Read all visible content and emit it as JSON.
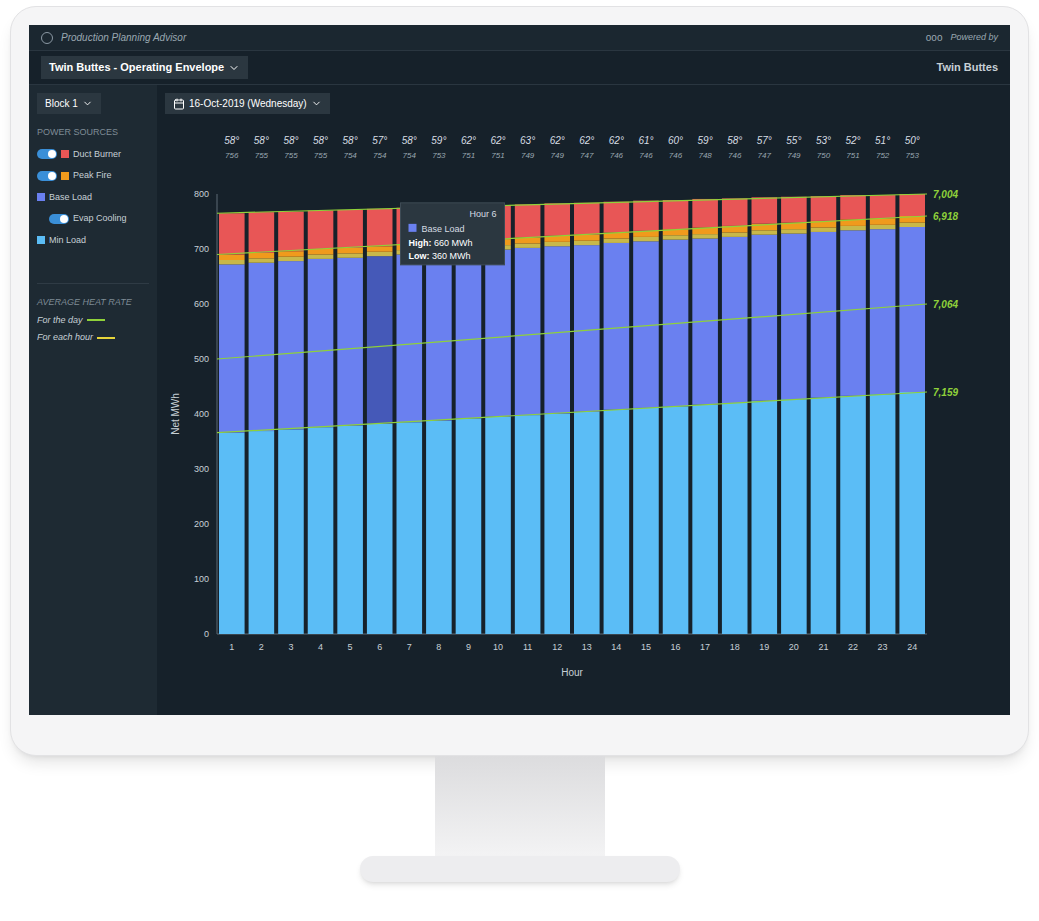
{
  "header": {
    "app": "Production Planning Advisor",
    "menu": "ooo",
    "poweredBy": "Powered by"
  },
  "plantSelect": "Twin Buttes - Operating Envelope",
  "siteName": "Twin Buttes",
  "blockSelect": "Block 1",
  "dateSelect": "16-Oct-2019 (Wednesday)",
  "legend": {
    "title": "POWER SOURCES",
    "items": [
      {
        "label": "Duct Burner",
        "kind": "toggle",
        "on": true,
        "sub": false,
        "color": "#e85656"
      },
      {
        "label": "Peak Fire",
        "kind": "toggle",
        "on": true,
        "sub": false,
        "color": "#f09a1c"
      },
      {
        "label": "Base Load",
        "kind": "plain",
        "sub": false,
        "color": "#6a80f0"
      },
      {
        "label": "Evap Cooling",
        "kind": "toggle",
        "on": true,
        "sub": true
      },
      {
        "label": "Min Load",
        "kind": "plain",
        "sub": false,
        "color": "#5bbdf6"
      }
    ]
  },
  "heatRate": {
    "title": "AVERAGE HEAT RATE",
    "items": [
      {
        "label": "For the day",
        "color": "#8fd13a"
      },
      {
        "label": "For each hour",
        "color": "#e6d43a"
      }
    ]
  },
  "chart": {
    "yLabel": "Net MWh",
    "xLabel": "Hour",
    "yTicks": [
      "0",
      "100",
      "200",
      "300",
      "400",
      "500",
      "600",
      "700",
      "800"
    ],
    "hours": [
      {
        "hour": "1",
        "temp": "58°",
        "code": "756",
        "selected": false
      },
      {
        "hour": "2",
        "temp": "58°",
        "code": "755",
        "selected": false
      },
      {
        "hour": "3",
        "temp": "58°",
        "code": "755",
        "selected": false
      },
      {
        "hour": "4",
        "temp": "58°",
        "code": "755",
        "selected": false
      },
      {
        "hour": "5",
        "temp": "58°",
        "code": "754",
        "selected": false
      },
      {
        "hour": "6",
        "temp": "57°",
        "code": "754",
        "selected": true
      },
      {
        "hour": "7",
        "temp": "58°",
        "code": "754",
        "selected": false
      },
      {
        "hour": "8",
        "temp": "59°",
        "code": "753",
        "selected": false
      },
      {
        "hour": "9",
        "temp": "62°",
        "code": "751",
        "selected": false
      },
      {
        "hour": "10",
        "temp": "62°",
        "code": "751",
        "selected": false
      },
      {
        "hour": "11",
        "temp": "63°",
        "code": "749",
        "selected": false
      },
      {
        "hour": "12",
        "temp": "62°",
        "code": "749",
        "selected": false
      },
      {
        "hour": "13",
        "temp": "62°",
        "code": "747",
        "selected": false
      },
      {
        "hour": "14",
        "temp": "62°",
        "code": "746",
        "selected": false
      },
      {
        "hour": "15",
        "temp": "61°",
        "code": "746",
        "selected": false
      },
      {
        "hour": "16",
        "temp": "60°",
        "code": "746",
        "selected": false
      },
      {
        "hour": "17",
        "temp": "59°",
        "code": "748",
        "selected": false
      },
      {
        "hour": "18",
        "temp": "58°",
        "code": "746",
        "selected": false
      },
      {
        "hour": "19",
        "temp": "57°",
        "code": "747",
        "selected": false
      },
      {
        "hour": "20",
        "temp": "55°",
        "code": "749",
        "selected": false
      },
      {
        "hour": "21",
        "temp": "53°",
        "code": "750",
        "selected": false
      },
      {
        "hour": "22",
        "temp": "52°",
        "code": "751",
        "selected": false
      },
      {
        "hour": "23",
        "temp": "51°",
        "code": "752",
        "selected": false
      },
      {
        "hour": "24",
        "temp": "50°",
        "code": "753",
        "selected": false
      }
    ],
    "series": [
      {
        "name": "Min Load",
        "color": "#5bbdf6",
        "values": [
          366,
          369,
          372,
          376,
          379,
          382,
          385,
          388,
          392,
          395,
          398,
          401,
          404,
          408,
          411,
          414,
          417,
          420,
          424,
          427,
          430,
          433,
          436,
          440
        ]
      },
      {
        "name": "Base Load",
        "color": "#6a80f0",
        "values": [
          306,
          306,
          306,
          306,
          305,
          305,
          305,
          305,
          304,
          304,
          304,
          304,
          303,
          303,
          303,
          303,
          302,
          302,
          302,
          301,
          301,
          301,
          300,
          300
        ]
      },
      {
        "name": "Evap Cooling",
        "color": "#c8b84a",
        "values": [
          8,
          8,
          8,
          8,
          8,
          8,
          8,
          8,
          8,
          8,
          8,
          8,
          8,
          8,
          8,
          8,
          8,
          8,
          8,
          8,
          8,
          8,
          8,
          8
        ]
      },
      {
        "name": "Peak Fire",
        "color": "#f09a1c",
        "values": [
          10,
          10,
          10,
          10,
          10,
          10,
          11,
          11,
          11,
          11,
          11,
          11,
          11,
          11,
          11,
          11,
          12,
          12,
          12,
          12,
          12,
          12,
          12,
          12
        ]
      },
      {
        "name": "Duct Burner",
        "color": "#e85656",
        "values": [
          75,
          74,
          72,
          70,
          69,
          68,
          66,
          65,
          63,
          62,
          60,
          59,
          58,
          56,
          55,
          53,
          52,
          50,
          48,
          47,
          45,
          44,
          42,
          40
        ]
      }
    ],
    "heatRateLines": [
      {
        "label": "7,004",
        "start": 765,
        "end": 800
      },
      {
        "label": "6,918",
        "start": 690,
        "end": 760
      },
      {
        "label": "7,064",
        "start": 500,
        "end": 600
      },
      {
        "label": "7,159",
        "start": 366,
        "end": 440
      }
    ],
    "tooltip": {
      "title": "Hour 6",
      "series": "Base Load",
      "highLabel": "High:",
      "high": "660 MWh",
      "lowLabel": "Low:",
      "low": "360 MWh"
    }
  }
}
